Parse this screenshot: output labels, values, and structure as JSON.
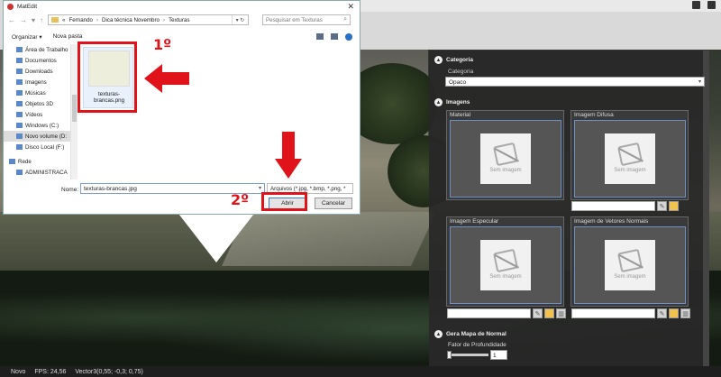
{
  "dialog": {
    "title": "MatEdit",
    "close_glyph": "✕",
    "breadcrumb": [
      "«",
      "Fernando",
      "Dica técnica Novembro",
      "Texturas"
    ],
    "search_placeholder": "Pesquisar em Texturas",
    "toolbar": {
      "organize": "Organizar ▾",
      "new_folder": "Nova pasta"
    },
    "sidebar": [
      "Área de Trabalho",
      "Documentos",
      "Downloads",
      "Imagens",
      "Músicas",
      "Objetos 3D",
      "Vídeos",
      "Windows (C:)",
      "Novo volume (D:",
      "Disco Local (F:)",
      "Rede",
      "ADMINISTRACA"
    ],
    "selected_sidebar": "Novo volume (D:",
    "file": {
      "name": "texturas-brancas.png"
    },
    "name_label": "Nome:",
    "name_value": "texturas-brancas.jpg",
    "file_type": "Arquivos (*.jpg, *.bmp, *.png, *",
    "open_label": "Abrir",
    "cancel_label": "Cancelar"
  },
  "annotations": {
    "step1": "1º",
    "step2": "2º",
    "accent": "#e0121a"
  },
  "panel": {
    "categoria_header": "Categoria",
    "categoria_label": "Categoria",
    "categoria_value": "Opaco",
    "imagens_header": "Imagens",
    "image_boxes": [
      "Material",
      "Imagem Difusa",
      "Imagem Especular",
      "Imagem de Vetores Normais"
    ],
    "no_image": "Sem imagem",
    "normal_header": "Gera Mapa de Normal",
    "depth_label": "Fator de Profundidade",
    "depth_value": "1"
  },
  "statusbar": {
    "mode": "Novo",
    "fps": "FPS: 24,56",
    "vector": "Vector3(0,55; -0,3; 0,75)"
  }
}
